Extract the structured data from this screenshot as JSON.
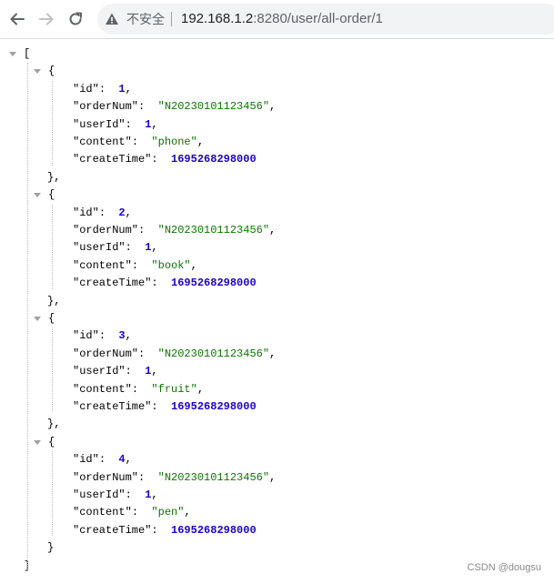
{
  "browser": {
    "security_label": "不安全",
    "url_host": "192.168.1.2",
    "url_path": ":8280/user/all-order/1"
  },
  "json": {
    "open_bracket": "[",
    "close_bracket": "]",
    "items": [
      {
        "id": "1",
        "orderNum": "\"N20230101123456\"",
        "userId": "1",
        "content": "\"phone\"",
        "createTime": "1695268298000"
      },
      {
        "id": "2",
        "orderNum": "\"N20230101123456\"",
        "userId": "1",
        "content": "\"book\"",
        "createTime": "1695268298000"
      },
      {
        "id": "3",
        "orderNum": "\"N20230101123456\"",
        "userId": "1",
        "content": "\"fruit\"",
        "createTime": "1695268298000"
      },
      {
        "id": "4",
        "orderNum": "\"N20230101123456\"",
        "userId": "1",
        "content": "\"pen\"",
        "createTime": "1695268298000"
      }
    ],
    "keys": {
      "id": "\"id\"",
      "orderNum": "\"orderNum\"",
      "userId": "\"userId\"",
      "content": "\"content\"",
      "createTime": "\"createTime\""
    }
  },
  "watermark": "CSDN @dougsu",
  "colors": {
    "string": "#0b7500",
    "number": "#1a01cc"
  }
}
